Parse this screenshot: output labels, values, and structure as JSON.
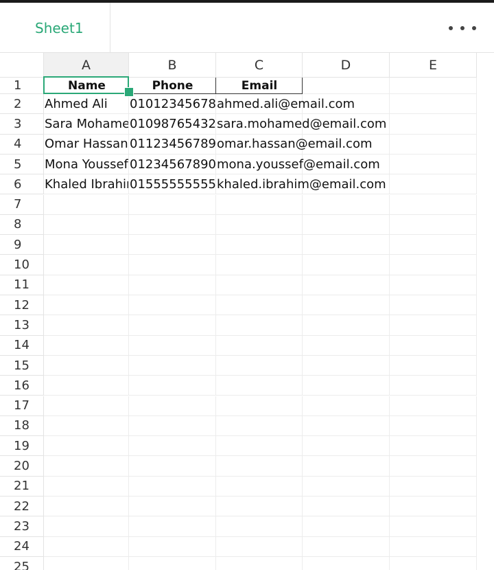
{
  "sheet_tab": {
    "label": "Sheet1"
  },
  "columns": [
    "A",
    "B",
    "C",
    "D",
    "E"
  ],
  "rows": [
    "1",
    "2",
    "3",
    "4",
    "5",
    "6",
    "7",
    "8",
    "9",
    "10",
    "11",
    "12",
    "13",
    "14",
    "15",
    "16",
    "17",
    "18",
    "19",
    "20",
    "21",
    "22",
    "23",
    "24",
    "25"
  ],
  "cells": [
    [
      "Name",
      "Phone",
      "Email"
    ],
    [
      "Ahmed Ali",
      "01012345678",
      "ahmed.ali@email.com"
    ],
    [
      "Sara Mohamed",
      "01098765432",
      "sara.mohamed@email.com"
    ],
    [
      "Omar Hassan",
      "01123456789",
      "omar.hassan@email.com"
    ],
    [
      "Mona Youssef",
      "01234567890",
      "mona.youssef@email.com"
    ],
    [
      "Khaled Ibrahim",
      "01555555555",
      "khaled.ibrahim@email.com"
    ]
  ],
  "selected_cell": "A1",
  "colors": {
    "accent": "#2aa877"
  }
}
